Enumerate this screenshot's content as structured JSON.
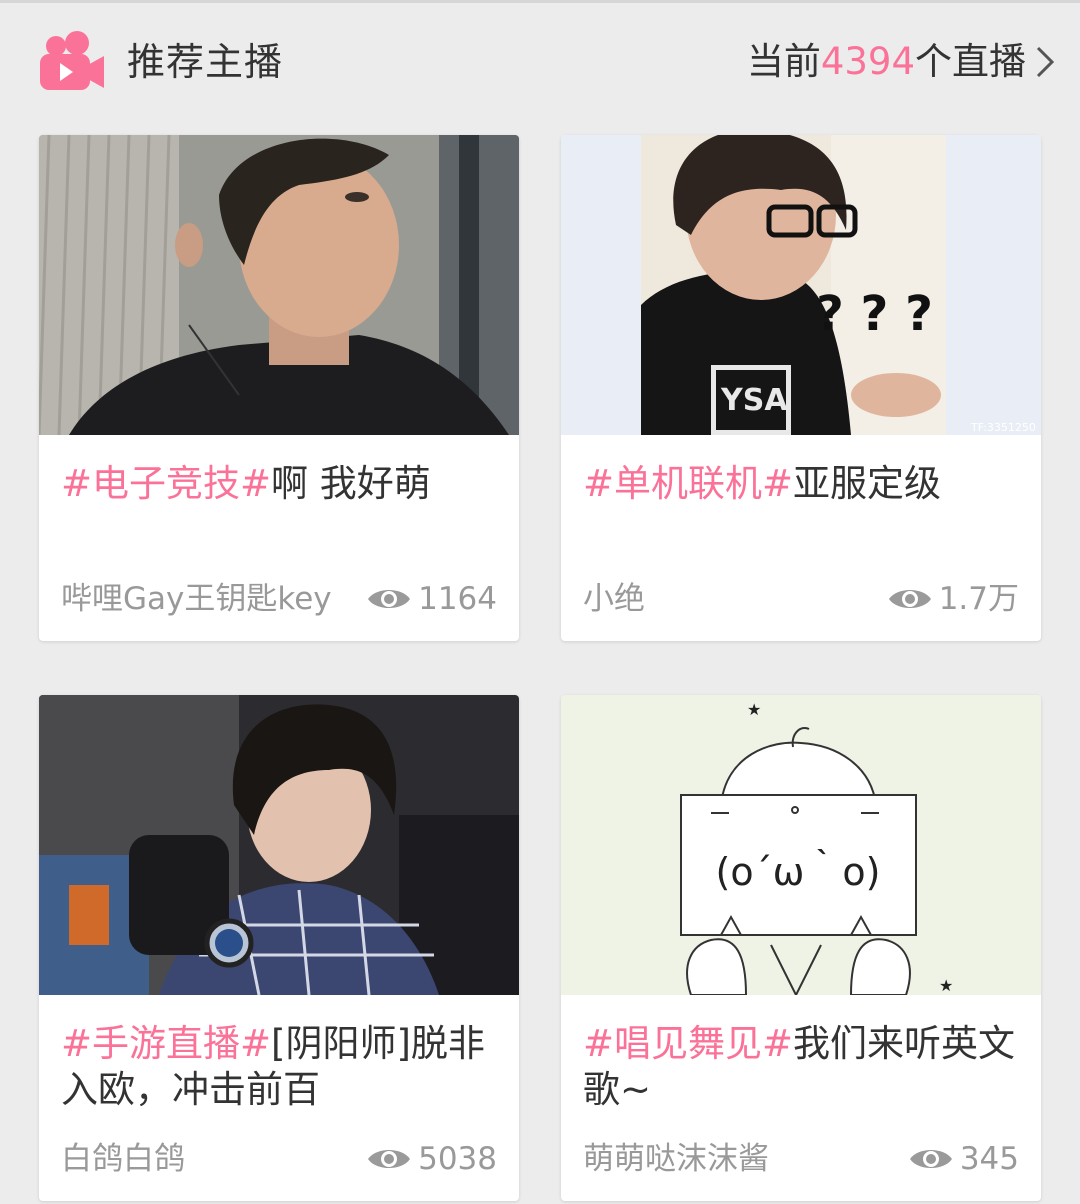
{
  "header": {
    "title": "推荐主播",
    "count_prefix": "当前",
    "count": "4394",
    "count_suffix": "个直播",
    "icon": "camera-icon",
    "chevron": "chevron-right-icon",
    "accent_color": "#fb7299"
  },
  "cards": [
    {
      "tag": "#电子竞技#",
      "title": "啊 我好萌",
      "author": "哔哩Gay王钥匙key",
      "views": "1164",
      "thumbnail": "photo of young man in black t-shirt looking sideways"
    },
    {
      "tag": "#单机联机#",
      "title": "亚服定级",
      "author": "小绝",
      "views": "1.7万",
      "thumbnail": "photo of young man with glasses and question marks"
    },
    {
      "tag": "#手游直播#",
      "title": "[阴阳师]脱非入欧，冲击前百",
      "author": "白鸽白鸽",
      "views": "5038",
      "thumbnail": "photo of young man in plaid shirt with watch"
    },
    {
      "tag": "#唱见舞见#",
      "title": "我们来听英文歌~",
      "author": "萌萌哒沫沫酱",
      "views": "345",
      "thumbnail": "cartoon character holding sign",
      "sign_text": "(o´ω｀o)"
    }
  ]
}
